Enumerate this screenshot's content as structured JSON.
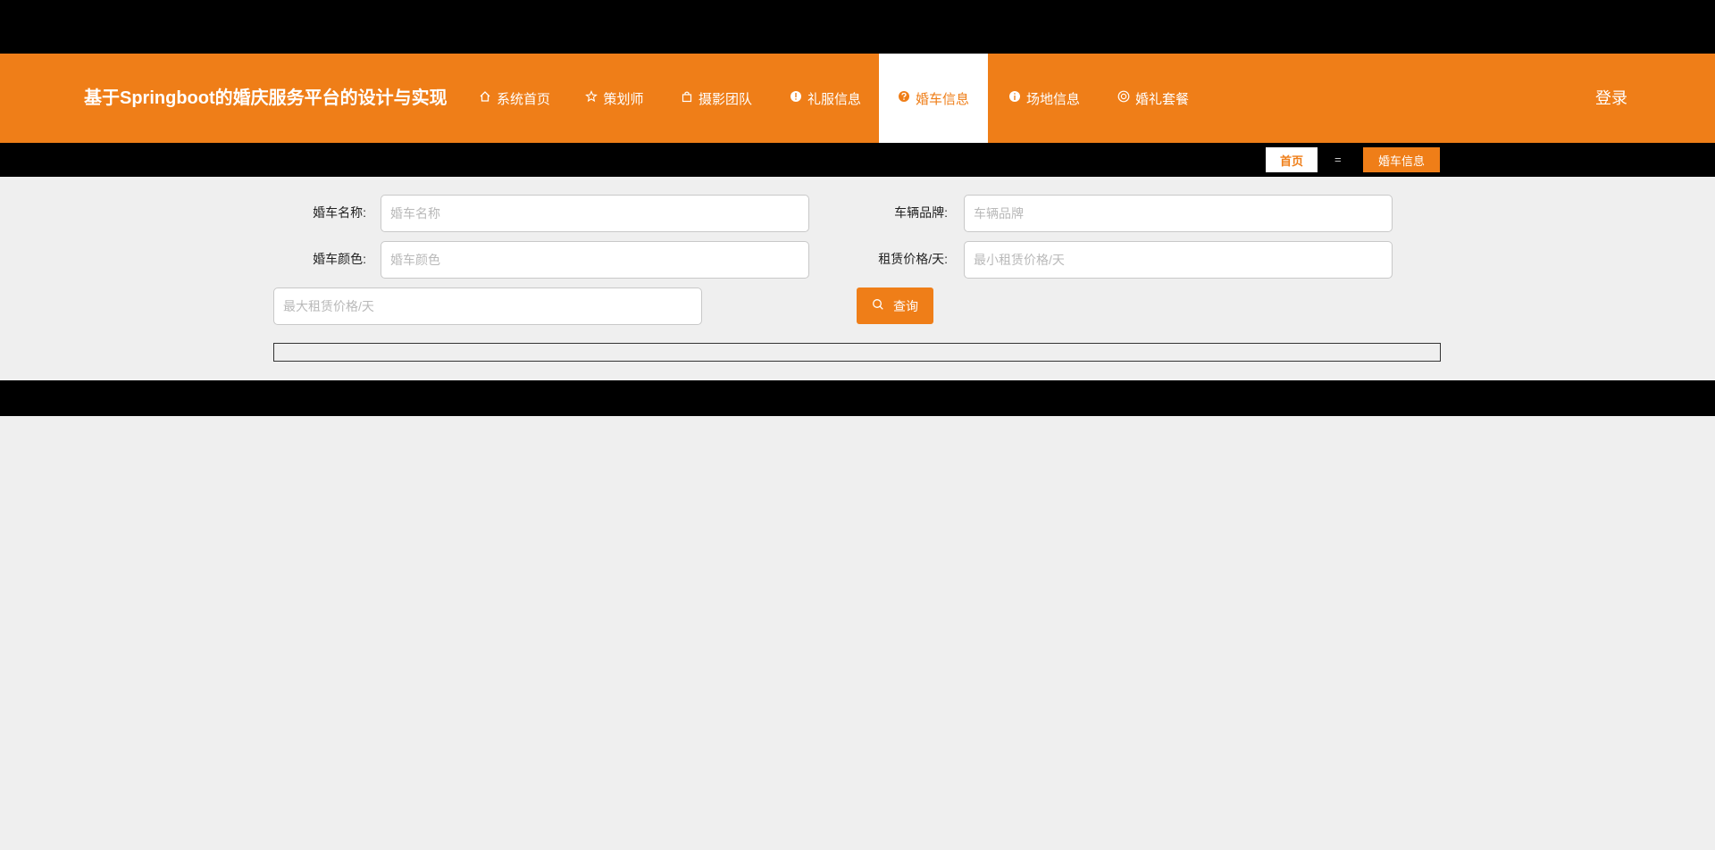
{
  "header": {
    "title": "基于Springboot的婚庆服务平台的设计与实现",
    "nav": [
      {
        "label": "系统首页",
        "icon": "home-icon"
      },
      {
        "label": "策划师",
        "icon": "star-icon"
      },
      {
        "label": "摄影团队",
        "icon": "bag-icon"
      },
      {
        "label": "礼服信息",
        "icon": "exclamation-icon"
      },
      {
        "label": "婚车信息",
        "icon": "question-icon",
        "active": true
      },
      {
        "label": "场地信息",
        "icon": "info-icon"
      },
      {
        "label": "婚礼套餐",
        "icon": "target-icon"
      }
    ],
    "login": "登录"
  },
  "breadcrumb": {
    "home": "首页",
    "separator": "=",
    "current": "婚车信息"
  },
  "search": {
    "name_label": "婚车名称:",
    "name_placeholder": "婚车名称",
    "brand_label": "车辆品牌:",
    "brand_placeholder": "车辆品牌",
    "color_label": "婚车颜色:",
    "color_placeholder": "婚车颜色",
    "price_label": "租赁价格/天:",
    "min_price_placeholder": "最小租赁价格/天",
    "max_price_placeholder": "最大租赁价格/天",
    "button_label": "查询"
  },
  "colors": {
    "brand": "#ef7e18",
    "background": "#efefef",
    "bar": "#000000"
  }
}
